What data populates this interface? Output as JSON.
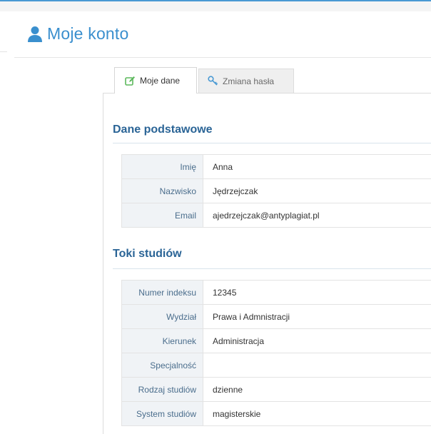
{
  "page": {
    "title": "Moje konto",
    "title_icon": "user-icon",
    "accent_color": "#3a8fce"
  },
  "tabs": [
    {
      "label": "Moje dane",
      "icon": "edit-icon",
      "active": true
    },
    {
      "label": "Zmiana hasła",
      "icon": "key-icon",
      "active": false
    }
  ],
  "sections": {
    "basic": {
      "title": "Dane podstawowe",
      "rows": [
        {
          "label": "Imię",
          "value": "Anna"
        },
        {
          "label": "Nazwisko",
          "value": "Jędrzejczak"
        },
        {
          "label": "Email",
          "value": "ajedrzejczak@antyplagiat.pl"
        }
      ]
    },
    "studies": {
      "title": "Toki studiów",
      "rows": [
        {
          "label": "Numer indeksu",
          "value": "12345"
        },
        {
          "label": "Wydział",
          "value": "Prawa i Admnistracji"
        },
        {
          "label": "Kierunek",
          "value": "Administracja"
        },
        {
          "label": "Specjalność",
          "value": ""
        },
        {
          "label": "Rodzaj studiów",
          "value": "dzienne"
        },
        {
          "label": "System studiów",
          "value": "magisterskie"
        }
      ]
    }
  }
}
